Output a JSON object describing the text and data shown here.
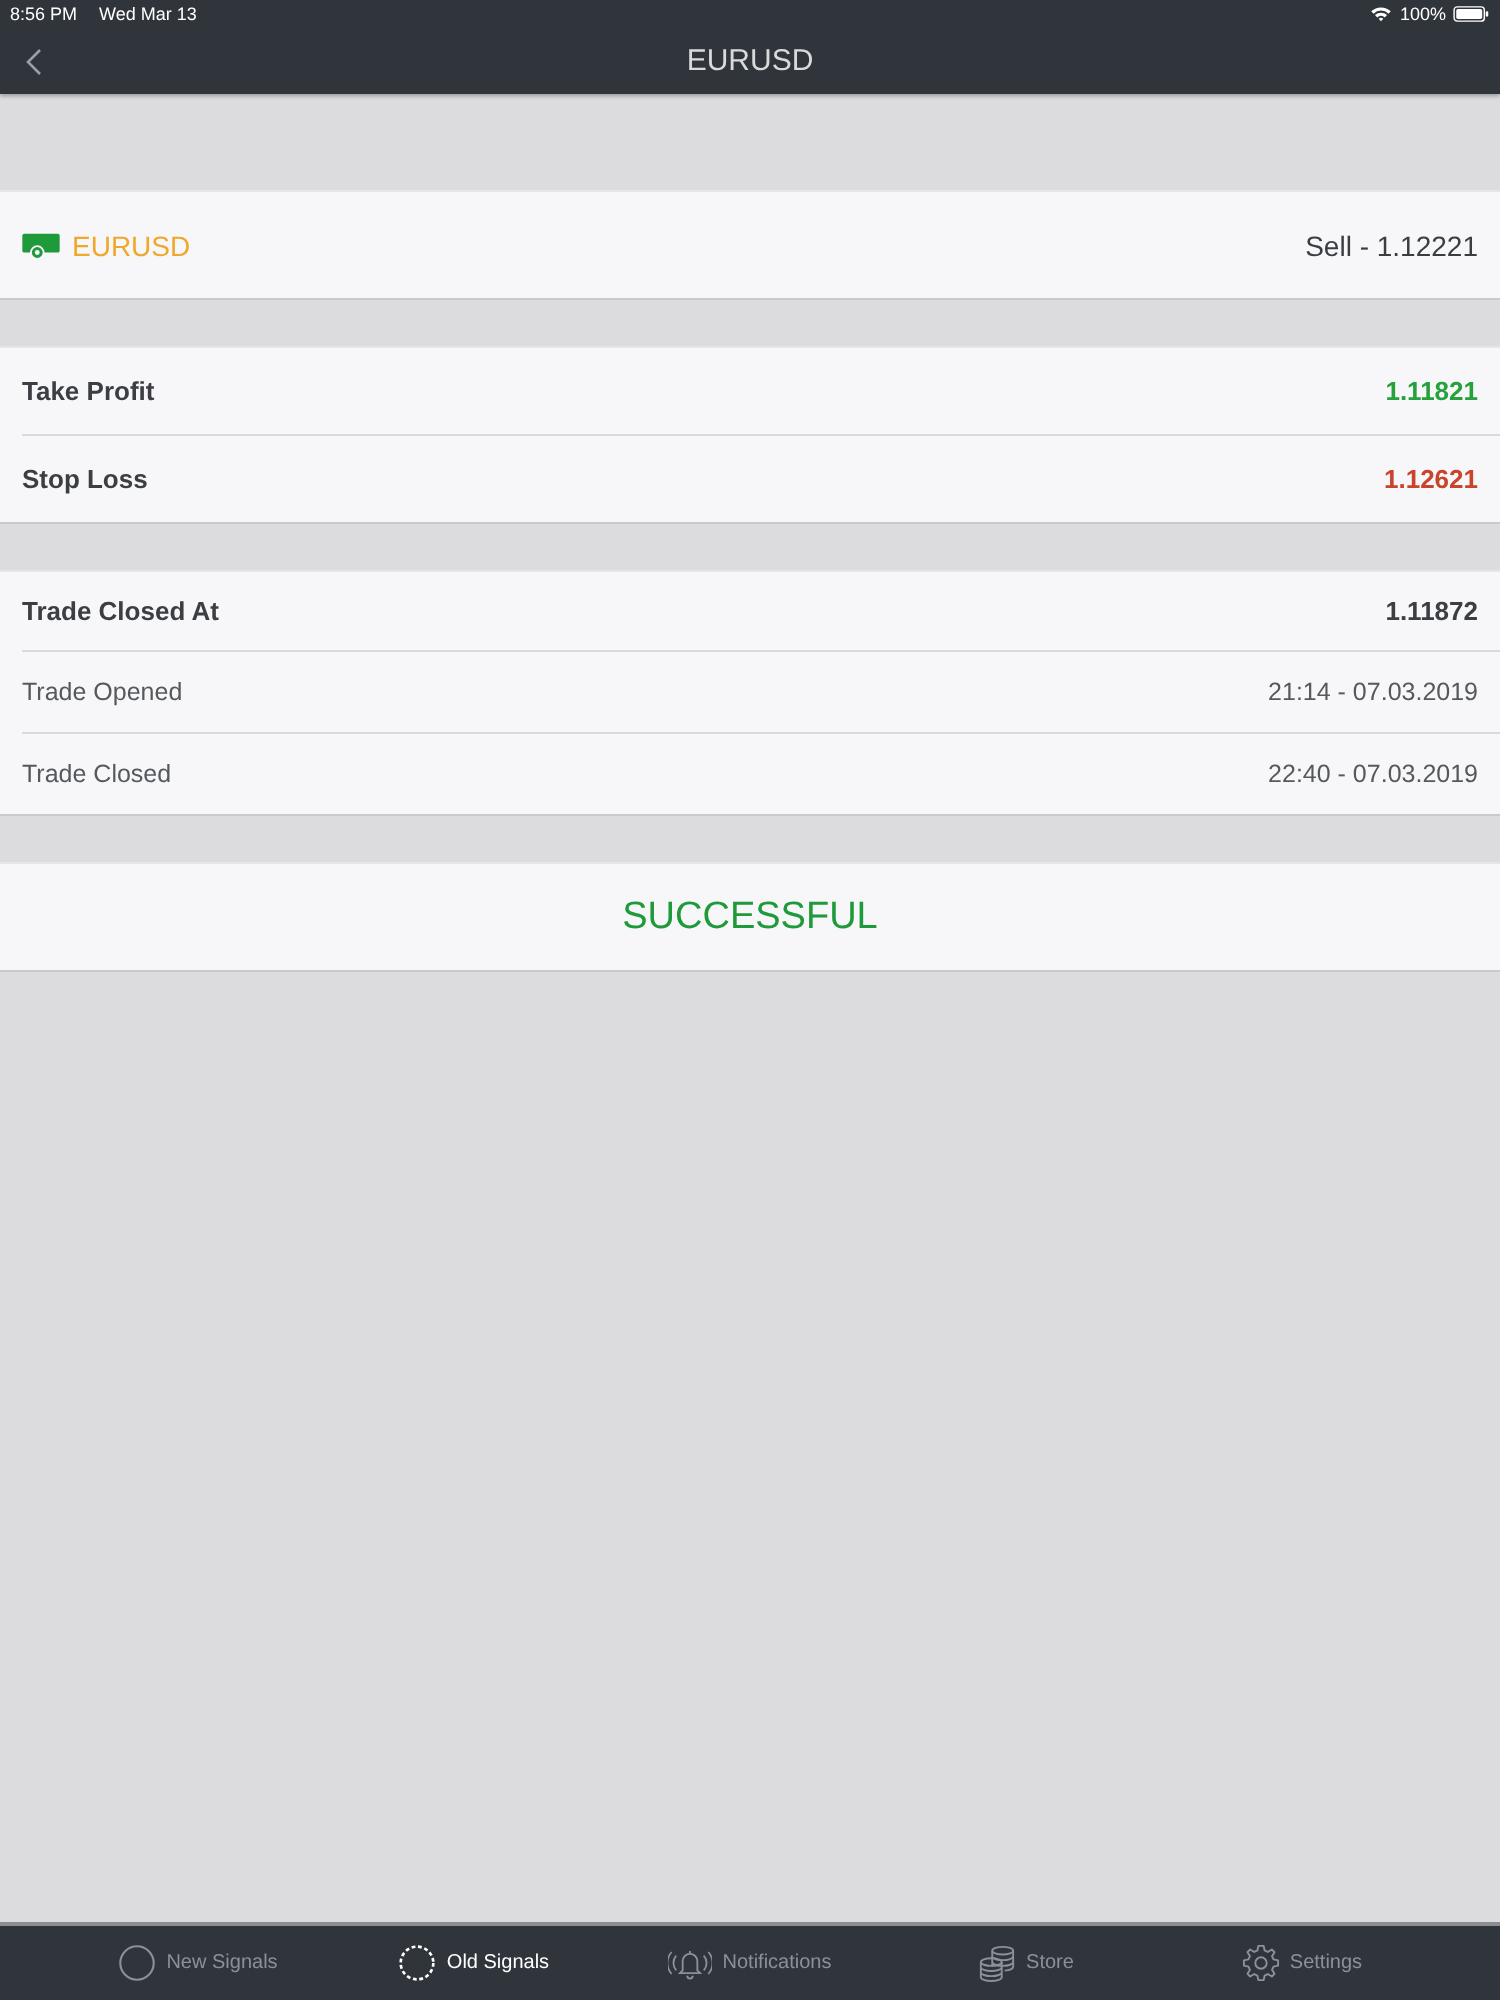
{
  "status_bar": {
    "time": "8:56 PM",
    "date": "Wed Mar 13",
    "battery": "100%"
  },
  "nav_bar": {
    "title": "EURUSD"
  },
  "signal": {
    "symbol": "EURUSD",
    "action": "Sell - 1.12221"
  },
  "targets": [
    {
      "label": "Take Profit",
      "value": "1.11821",
      "color": "#27a13c"
    },
    {
      "label": "Stop Loss",
      "value": "1.12621",
      "color": "#c9442b"
    }
  ],
  "details": [
    {
      "label": "Trade Closed At",
      "value": "1.11872",
      "kind": "summary"
    },
    {
      "label": "Trade Opened",
      "value": "21:14 - 07.03.2019",
      "kind": "time"
    },
    {
      "label": "Trade Closed",
      "value": "22:40 - 07.03.2019",
      "kind": "time"
    }
  ],
  "result": {
    "text": "SUCCESSFUL"
  },
  "tab_bar": [
    {
      "label": "New Signals",
      "selected": false
    },
    {
      "label": "Old Signals",
      "selected": true
    },
    {
      "label": "Notifications",
      "selected": false
    },
    {
      "label": "Store",
      "selected": false
    },
    {
      "label": "Settings",
      "selected": false
    }
  ]
}
